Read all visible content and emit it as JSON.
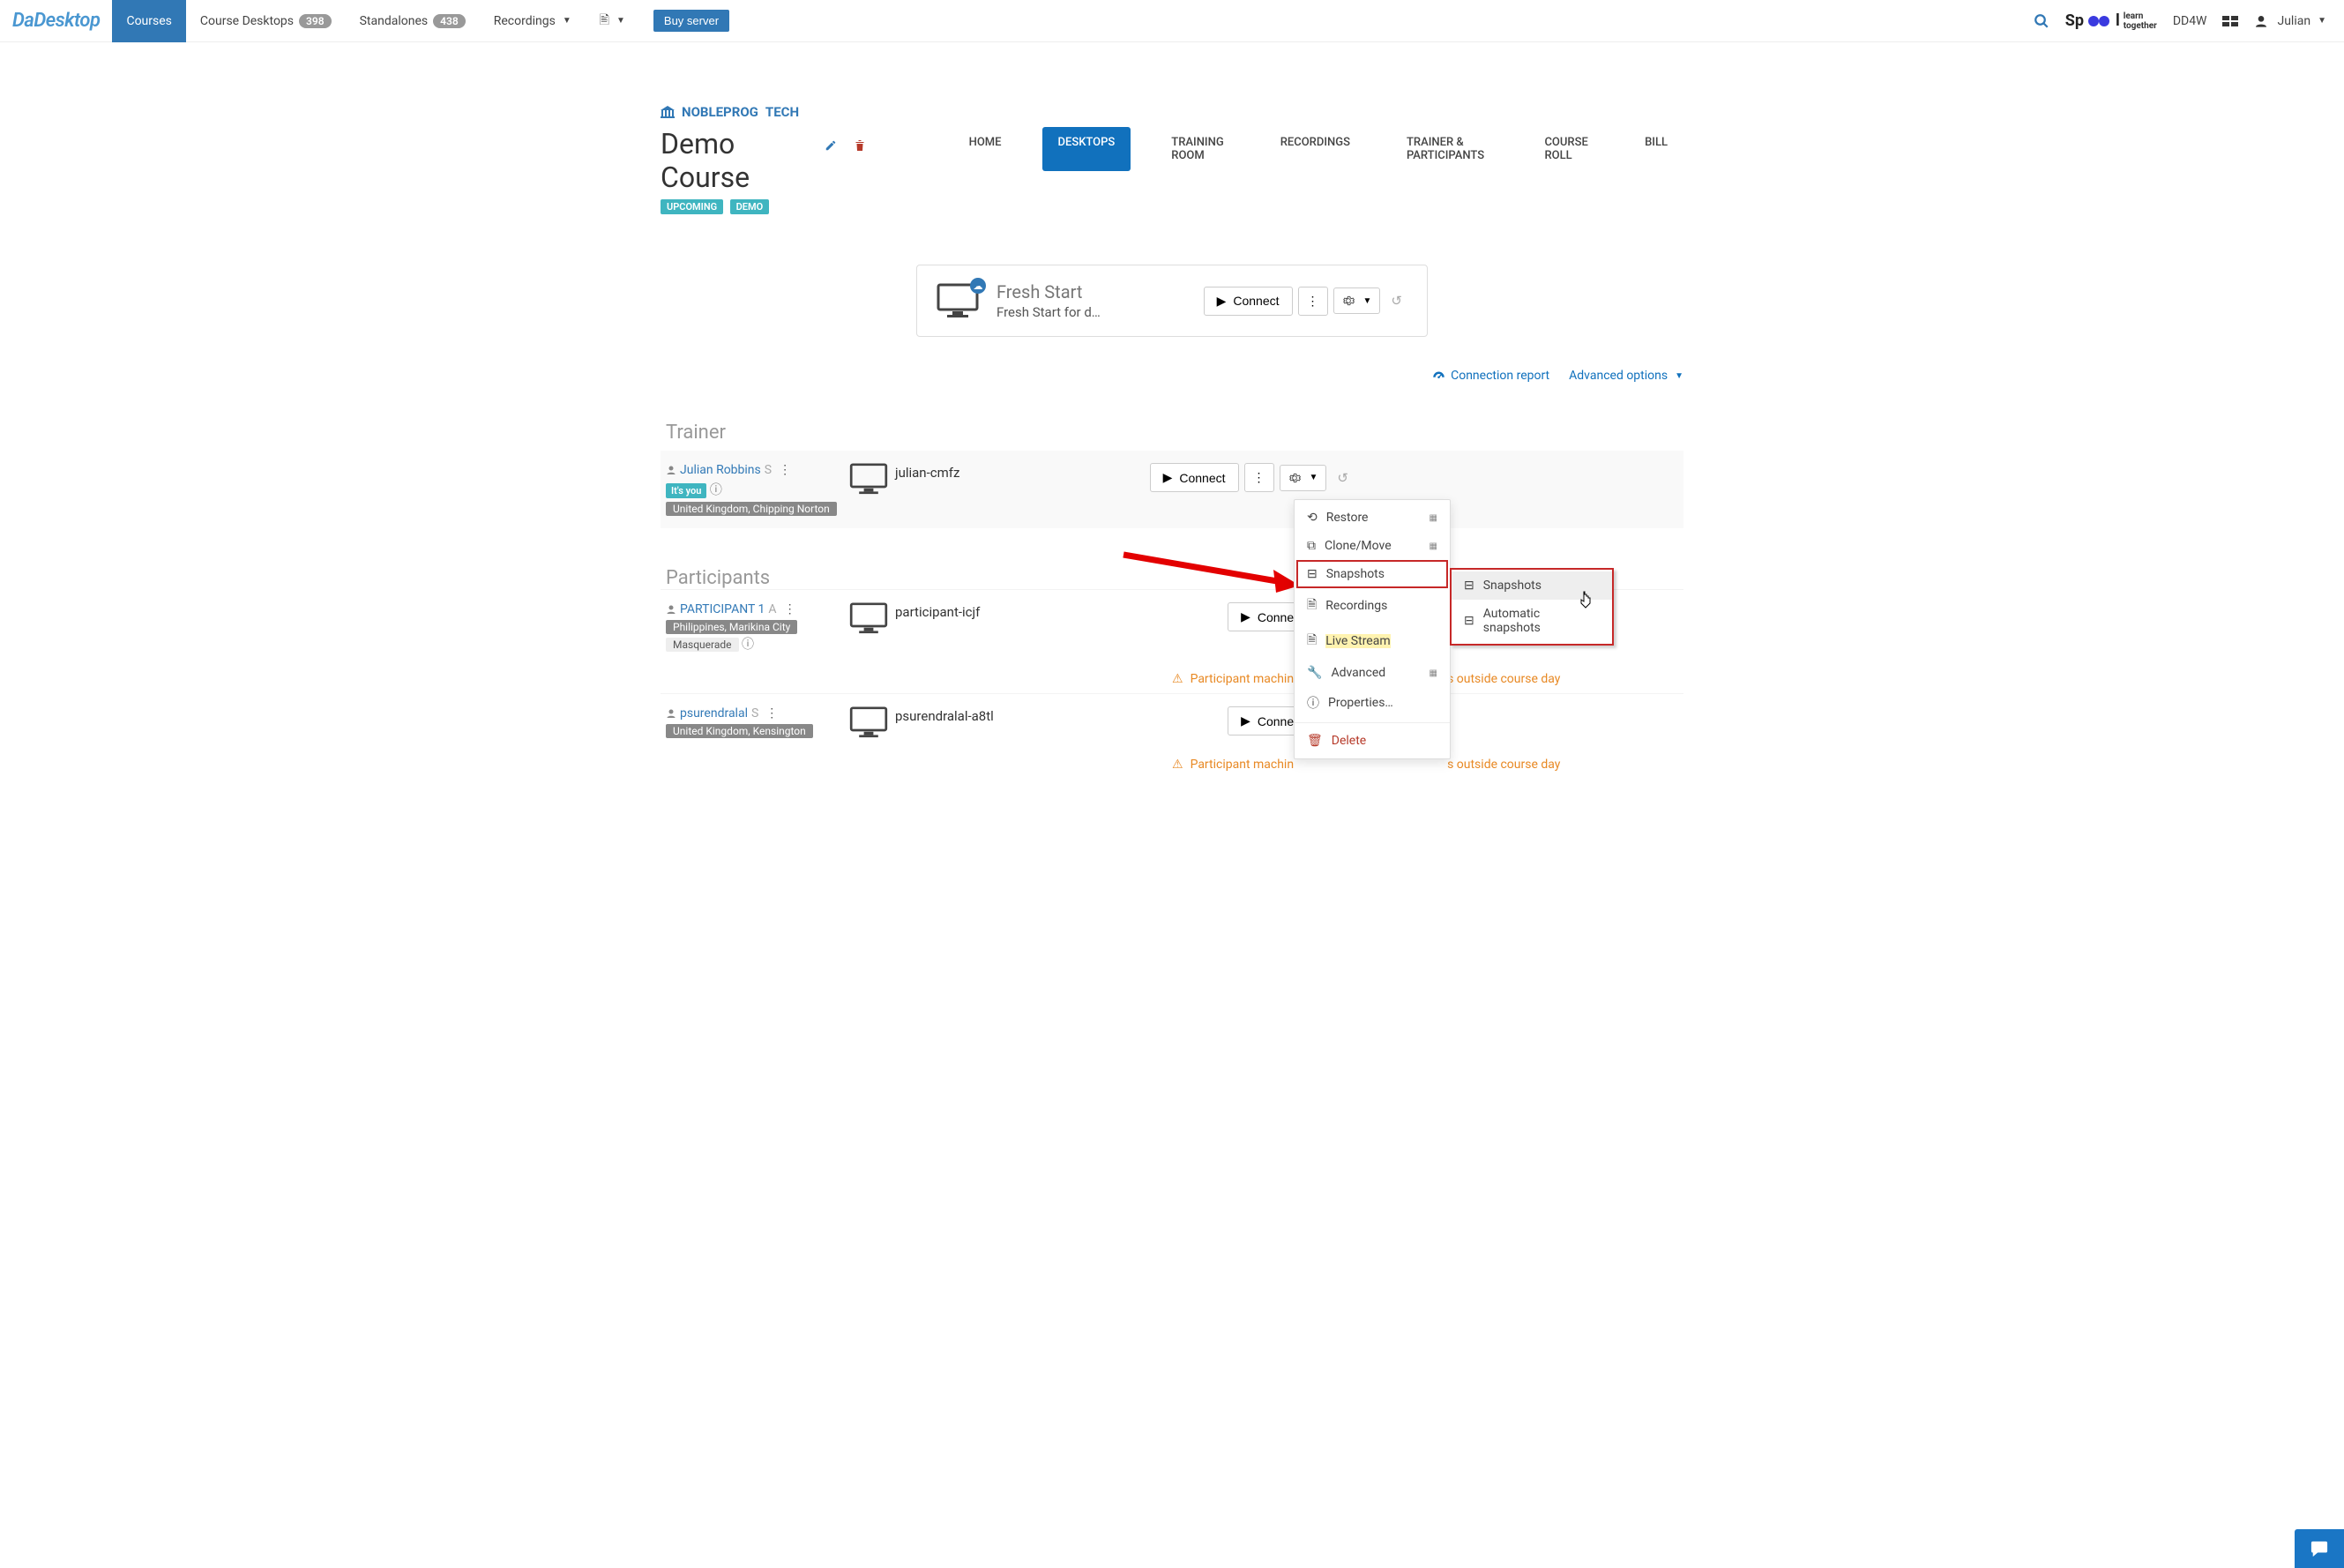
{
  "nav": {
    "logo": "DaDesktop",
    "courses": "Courses",
    "course_desktops": "Course Desktops",
    "course_desktops_count": "398",
    "standalones": "Standalones",
    "standalones_count": "438",
    "recordings": "Recordings",
    "buy_server": "Buy server",
    "dd4w": "DD4W",
    "user": "Julian",
    "spool": "Sp",
    "spool2": "l",
    "spool_sub1": "learn",
    "spool_sub2": "together"
  },
  "breadcrumb": {
    "org": "NOBLEPROG",
    "dept": "TECH"
  },
  "course": {
    "title": "Demo Course",
    "tag1": "UPCOMING",
    "tag2": "DEMO"
  },
  "tabs": {
    "home": "HOME",
    "desktops": "DESKTOPS",
    "training_room": "TRAINING ROOM",
    "recordings": "RECORDINGS",
    "trainer_participants": "TRAINER & PARTICIPANTS",
    "course_roll": "COURSE ROLL",
    "bill": "BILL"
  },
  "fresh": {
    "title": "Fresh Start",
    "sub": "Fresh Start for d…",
    "connect": "Connect"
  },
  "links": {
    "conn_report": "Connection report",
    "adv_options": "Advanced options"
  },
  "sections": {
    "trainer": "Trainer",
    "participants": "Participants"
  },
  "trainer": {
    "name": "Julian Robbins",
    "suffix": "S",
    "you": "It's you",
    "loc": "United Kingdom, Chipping Norton",
    "machine": "julian-cmfz",
    "connect": "Connect"
  },
  "p1": {
    "name": "PARTICIPANT 1",
    "suffix": "A",
    "loc": "Philippines, Marikina City",
    "masq": "Masquerade",
    "machine": "participant-icjf",
    "connect": "Connect",
    "warn": "Participant machin",
    "warn2": "s outside course day"
  },
  "p2": {
    "name": "psurendralal",
    "suffix": "S",
    "loc": "United Kingdom, Kensington",
    "machine": "psurendralal-a8tl",
    "connect": "Connect",
    "warn": "Participant machin",
    "warn2": "s outside course day"
  },
  "menu": {
    "restore": "Restore",
    "clone": "Clone/Move",
    "snapshots": "Snapshots",
    "recordings": "Recordings",
    "live": "Live Stream",
    "advanced": "Advanced",
    "properties": "Properties…",
    "delete": "Delete"
  },
  "submenu": {
    "snapshots": "Snapshots",
    "auto": "Automatic snapshots"
  }
}
